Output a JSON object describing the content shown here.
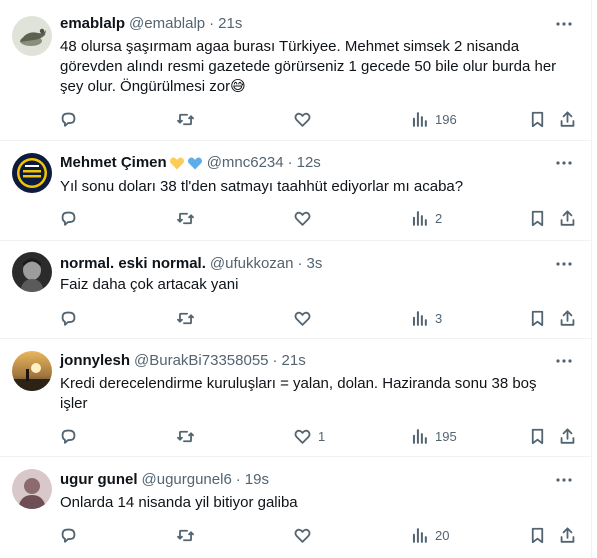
{
  "tweets": [
    {
      "name": "emablalp",
      "handle": "@emablalp",
      "time": "21s",
      "text": "48 olursa şaşırmam agaa burası Türkiyee. Mehmet simsek 2 nisanda görevden alındı resmi gazetede görürseniz 1 gecede 50 bile olur burda her şey olur. Öngürülmesi zor😅",
      "replies": "",
      "retweets": "",
      "likes": "",
      "views": "196"
    },
    {
      "name": "Mehmet Çimen",
      "name_emojis": [
        "yellow-heart",
        "blue-heart"
      ],
      "handle": "@mnc6234",
      "time": "12s",
      "text": "Yıl sonu doları 38 tl'den satmayı taahhüt ediyorlar mı acaba?",
      "replies": "",
      "retweets": "",
      "likes": "",
      "views": "2"
    },
    {
      "name": "normal. eski normal.",
      "handle": "@ufukkozan",
      "time": "3s",
      "text": "Faiz daha çok artacak yani",
      "replies": "",
      "retweets": "",
      "likes": "",
      "views": "3"
    },
    {
      "name": "jonnylesh",
      "handle": "@BurakBi73358055",
      "time": "21s",
      "text": "Kredi derecelendirme kuruluşları = yalan, dolan. Haziranda sonu 38 boş işler",
      "replies": "",
      "retweets": "",
      "likes": "1",
      "views": "195"
    },
    {
      "name": "ugur gunel",
      "handle": "@ugurgunel6",
      "time": "19s",
      "text": "Onlarda 14 nisanda yil bitiyor galiba",
      "replies": "",
      "retweets": "",
      "likes": "",
      "views": "20"
    }
  ],
  "separator": "·",
  "icons": {
    "more": "more-horizontal-icon",
    "reply": "reply-icon",
    "retweet": "retweet-icon",
    "like": "heart-icon",
    "views": "views-chart-icon",
    "bookmark": "bookmark-icon",
    "share": "share-icon"
  },
  "colors": {
    "text": "#0f1419",
    "secondary": "#536471",
    "border": "#eff3f4",
    "yellow_heart": "#fdcb58",
    "blue_heart": "#5dadec"
  }
}
